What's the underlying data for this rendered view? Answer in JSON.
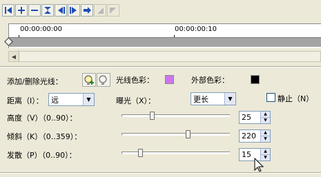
{
  "toolbar": {
    "icons": [
      "go-start-icon",
      "add-keyframe-icon",
      "remove-keyframe-icon",
      "reverse-icon",
      "prev-keyframe-icon",
      "next-keyframe-icon",
      "go-end-icon",
      "prev-frame-icon",
      "next-frame-icon"
    ]
  },
  "timeline": {
    "start_time": "00:00:00:00",
    "mid_time": "00:00:00:10"
  },
  "light": {
    "add_remove_label": "添加/删除光线：",
    "light_color_label": "光线色彩：",
    "light_color": "#cc77ee",
    "outer_color_label": "外部色彩：",
    "outer_color": "#000000"
  },
  "distance": {
    "label": "距离（I）：",
    "value": "远"
  },
  "exposure": {
    "label": "曝光（X）：",
    "value": "更长"
  },
  "still": {
    "label": "静止（N）",
    "checked": false
  },
  "height": {
    "label": "高度（V）（0..90）：",
    "value": "25",
    "fraction": 0.28
  },
  "tilt": {
    "label": "倾斜（K）（0..359）：",
    "value": "220",
    "fraction": 0.61
  },
  "spread": {
    "label": "发散（P）（0..90）：",
    "value": "15",
    "fraction": 0.17
  },
  "colors": {
    "bg": "#ece9d8",
    "track": "#a4a4a4",
    "accent_blue": "#1f4fb5"
  }
}
